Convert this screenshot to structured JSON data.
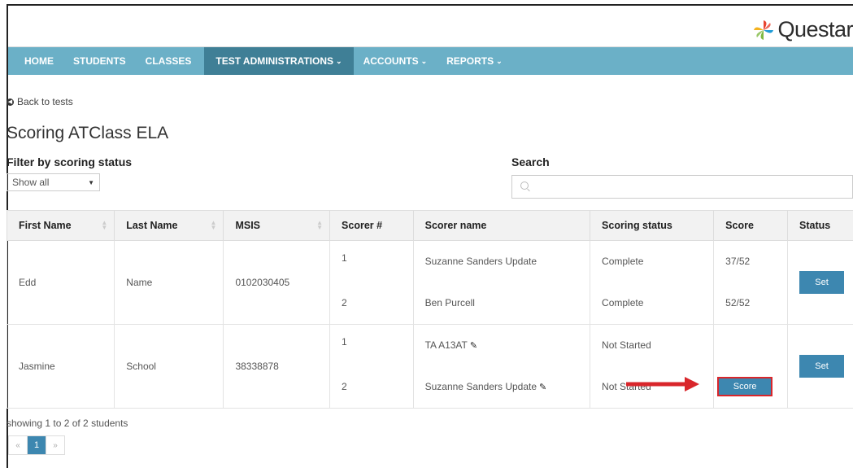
{
  "logo": {
    "text": "Questar",
    "icon": "questar-pinwheel-icon",
    "colors": [
      "#e8442f",
      "#f4b21f",
      "#7fb942",
      "#1f9bd7"
    ]
  },
  "nav": {
    "items": [
      {
        "label": "HOME",
        "dropdown": false
      },
      {
        "label": "STUDENTS",
        "dropdown": false
      },
      {
        "label": "CLASSES",
        "dropdown": false
      },
      {
        "label": "TEST ADMINISTRATIONS",
        "dropdown": true,
        "active": true
      },
      {
        "label": "ACCOUNTS",
        "dropdown": true
      },
      {
        "label": "REPORTS",
        "dropdown": true
      }
    ],
    "bg_color": "#6bb0c7",
    "active_color": "#3f7f96"
  },
  "back_link": "Back to tests",
  "page_title": "Scoring ATClass ELA",
  "filter": {
    "label": "Filter by scoring status",
    "selected": "Show all"
  },
  "search": {
    "label": "Search",
    "placeholder": ""
  },
  "table": {
    "headers": [
      "First Name",
      "Last Name",
      "MSIS",
      "Scorer #",
      "Scorer name",
      "Scoring status",
      "Score",
      "Status"
    ],
    "rows": [
      {
        "first_name": "Edd",
        "last_name": "Name",
        "msis": "0102030405",
        "scorers": [
          {
            "num": "1",
            "name": "Suzanne Sanders Update",
            "status": "Complete",
            "score": "37/52"
          },
          {
            "num": "2",
            "name": "Ben Purcell",
            "status": "Complete",
            "score": "52/52"
          }
        ],
        "action": "Set"
      },
      {
        "first_name": "Jasmine",
        "last_name": "School",
        "msis": "38338878",
        "scorers": [
          {
            "num": "1",
            "name": "TA A13AT",
            "status": "Not Started",
            "score": ""
          },
          {
            "num": "2",
            "name": "Suzanne Sanders Update",
            "status": "Not Started",
            "score": "Score"
          }
        ],
        "action": "Set"
      }
    ]
  },
  "footer": {
    "showing": "showing 1 to 2 of 2 students",
    "pager": {
      "prev": "«",
      "current": "1",
      "next": "»"
    }
  },
  "accent": "#3d87b0",
  "highlight": "#d9262b"
}
